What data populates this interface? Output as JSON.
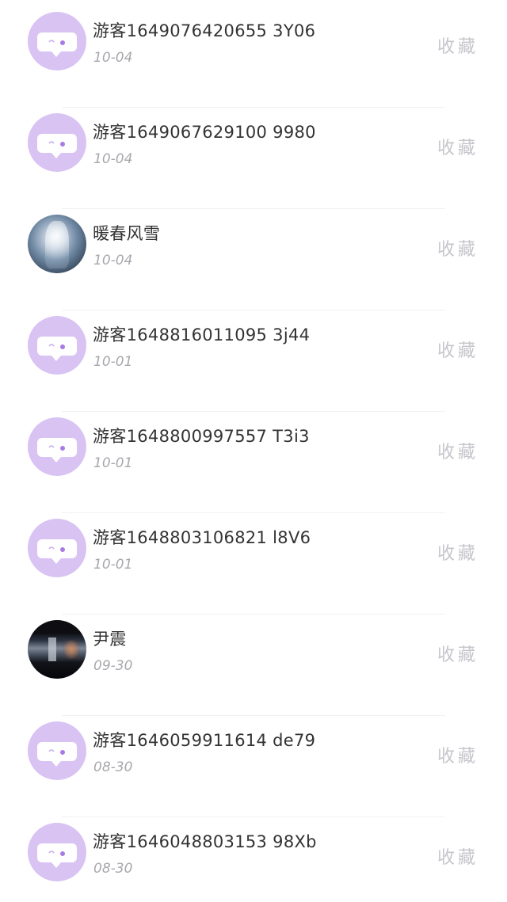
{
  "action_label": "收藏",
  "colors": {
    "guest_avatar_bg": "#d9c3f3",
    "name_text": "#333333",
    "date_text": "#a7a7ad",
    "action_text": "#c5c5cb"
  },
  "visitors": [
    {
      "name": "游客1649076420655 3Y06",
      "date": "10-04",
      "avatar": "guest-chat-icon"
    },
    {
      "name": "游客1649067629100 9980",
      "date": "10-04",
      "avatar": "guest-chat-icon"
    },
    {
      "name": "暖春风雪",
      "date": "10-04",
      "avatar": "user-photo"
    },
    {
      "name": "游客1648816011095 3j44",
      "date": "10-01",
      "avatar": "guest-chat-icon"
    },
    {
      "name": "游客1648800997557 T3i3",
      "date": "10-01",
      "avatar": "guest-chat-icon"
    },
    {
      "name": "游客1648803106821 l8V6",
      "date": "10-01",
      "avatar": "guest-chat-icon"
    },
    {
      "name": "尹震",
      "date": "09-30",
      "avatar": "user-photo"
    },
    {
      "name": "游客1646059911614 de79",
      "date": "08-30",
      "avatar": "guest-chat-icon"
    },
    {
      "name": "游客1646048803153 98Xb",
      "date": "08-30",
      "avatar": "guest-chat-icon"
    }
  ]
}
